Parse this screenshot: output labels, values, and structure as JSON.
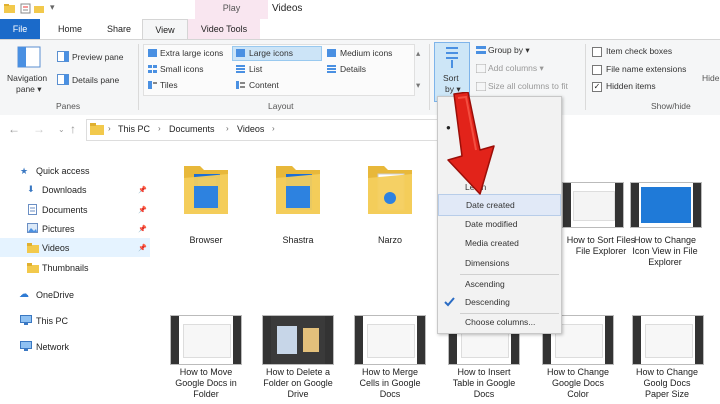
{
  "window": {
    "title": "Videos",
    "context_tab": "Play"
  },
  "tabs": {
    "file": "File",
    "home": "Home",
    "share": "Share",
    "view": "View",
    "video_tools": "Video Tools"
  },
  "ribbon": {
    "panes": {
      "navigation_pane": "Navigation",
      "navigation_pane_2": "pane ▾",
      "preview_pane": "Preview pane",
      "details_pane": "Details pane",
      "group_label": "Panes"
    },
    "layout": {
      "extra_large_icons": "Extra large icons",
      "large_icons": "Large icons",
      "medium_icons": "Medium icons",
      "small_icons": "Small icons",
      "list": "List",
      "details": "Details",
      "tiles": "Tiles",
      "content": "Content",
      "group_label": "Layout"
    },
    "current_view": {
      "sort": "Sort",
      "sort_by_suffix": "by ▾",
      "group_by": "Group by ▾",
      "add_columns": "Add columns ▾",
      "size_columns": "Size all columns to fit",
      "menu_title_fragment": "me"
    },
    "show_hide": {
      "item_check_boxes": "Item check boxes",
      "file_name_extensions": "File name extensions",
      "hidden_items": "Hidden items",
      "hide_fragment": "Hide",
      "group_label": "Show/hide"
    }
  },
  "address": {
    "segments": [
      "This PC",
      "Documents",
      "Videos"
    ]
  },
  "nav": {
    "quick_access": "Quick access",
    "downloads": "Downloads",
    "documents": "Documents",
    "pictures": "Pictures",
    "videos": "Videos",
    "thumbnails": "Thumbnails",
    "onedrive": "OneDrive",
    "this_pc": "This PC",
    "network": "Network"
  },
  "content": {
    "folders": [
      "Browser",
      "Shastra",
      "Narzo"
    ],
    "row1_videos": [
      {
        "line1": "How to Sort Files",
        "line2": "File Explorer"
      },
      {
        "line1": "How to Change",
        "line2": "Icon View in File",
        "line3": "Explorer"
      }
    ],
    "row2_videos": [
      {
        "line1": "How to Move",
        "line2": "Google Docs in",
        "line3": "Folder"
      },
      {
        "line1": "How to Delete a",
        "line2": "Folder on Google",
        "line3": "Drive"
      },
      {
        "line1": "How to Merge",
        "line2": "Cells in Google",
        "line3": "Docs"
      },
      {
        "line1": "How to Insert",
        "line2": "Table in Google",
        "line3": "Docs"
      },
      {
        "line1": "How to Change",
        "line2": "Google Docs",
        "line3": "Color"
      },
      {
        "line1": "How to Change",
        "line2": "Goolg Docs",
        "line3": "Paper Size"
      }
    ]
  },
  "sort_menu": {
    "partial_item": "Le...h",
    "date_created": "Date created",
    "date_modified": "Date modified",
    "media_created": "Media created",
    "dimensions": "Dimensions",
    "ascending": "Ascending",
    "descending": "Descending",
    "choose_columns": "Choose columns..."
  },
  "colors": {
    "accent": "#1b6ac9",
    "folder": "#f2c94c",
    "arrow": "#e2231a",
    "play_tab": "#f9e6f0"
  }
}
